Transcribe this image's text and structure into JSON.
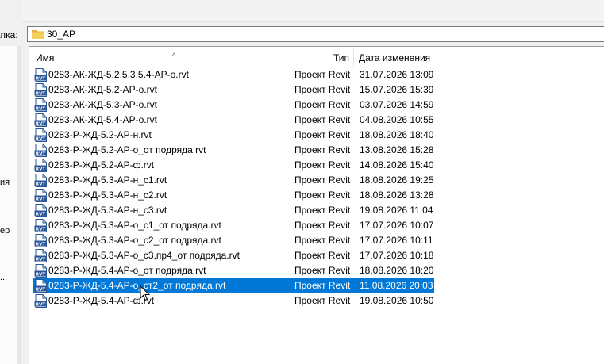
{
  "folder": {
    "label": "апка:",
    "current": "30_АР"
  },
  "left_pane": {
    "items": [
      "ия",
      "ер",
      "..."
    ]
  },
  "columns": {
    "name": "Имя",
    "type": "Тип",
    "date": "Дата изменения"
  },
  "files": [
    {
      "name": "0283-АК-ЖД-5.2,5.3,5.4-АР-о.rvt",
      "type": "Проект Revit",
      "date": "31.07.2026 13:09"
    },
    {
      "name": "0283-АК-ЖД-5.2-АР-о.rvt",
      "type": "Проект Revit",
      "date": "15.07.2026 15:39"
    },
    {
      "name": "0283-АК-ЖД-5.3-АР-о.rvt",
      "type": "Проект Revit",
      "date": "03.07.2026 14:59"
    },
    {
      "name": "0283-АК-ЖД-5.4-АР-о.rvt",
      "type": "Проект Revit",
      "date": "04.08.2026 10:55"
    },
    {
      "name": "0283-Р-ЖД-5.2-АР-н.rvt",
      "type": "Проект Revit",
      "date": "18.08.2026 18:40"
    },
    {
      "name": "0283-Р-ЖД-5.2-АР-о_от подряда.rvt",
      "type": "Проект Revit",
      "date": "13.08.2026 15:28"
    },
    {
      "name": "0283-Р-ЖД-5.2-АР-ф.rvt",
      "type": "Проект Revit",
      "date": "14.08.2026 15:40"
    },
    {
      "name": "0283-Р-ЖД-5.3-АР-н_с1.rvt",
      "type": "Проект Revit",
      "date": "18.08.2026 19:25"
    },
    {
      "name": "0283-Р-ЖД-5.3-АР-н_с2.rvt",
      "type": "Проект Revit",
      "date": "18.08.2026 13:28"
    },
    {
      "name": "0283-Р-ЖД-5.3-АР-н_с3.rvt",
      "type": "Проект Revit",
      "date": "19.08.2026 11:04"
    },
    {
      "name": "0283-Р-ЖД-5.3-АР-о_с1_от подряда.rvt",
      "type": "Проект Revit",
      "date": "17.07.2026 10:07"
    },
    {
      "name": "0283-Р-ЖД-5.3-АР-о_с2_от подряда.rvt",
      "type": "Проект Revit",
      "date": "17.07.2026 10:11"
    },
    {
      "name": "0283-Р-ЖД-5.3-АР-о_с3,пр4_от подряда.rvt",
      "type": "Проект Revit",
      "date": "17.07.2026 10:18"
    },
    {
      "name": "0283-Р-ЖД-5.4-АР-о_от подряда.rvt",
      "type": "Проект Revit",
      "date": "18.08.2026 18:20"
    },
    {
      "name": "0283-Р-ЖД-5.4-АР-о_ст2_от подряда.rvt",
      "type": "Проект Revit",
      "date": "11.08.2026 20:03",
      "selected": true
    },
    {
      "name": "0283-Р-ЖД-5.4-АР-ф.rvt",
      "type": "Проект Revit",
      "date": "19.08.2026 10:50"
    }
  ],
  "icons": {
    "file_icon": "rvt-file-icon",
    "file_icon_text": "RVT",
    "folder_icon": "folder-icon"
  },
  "colors": {
    "selection": "#0078d7",
    "icon_blue": "#2b5797",
    "folder_yellow": "#f2c94c"
  }
}
